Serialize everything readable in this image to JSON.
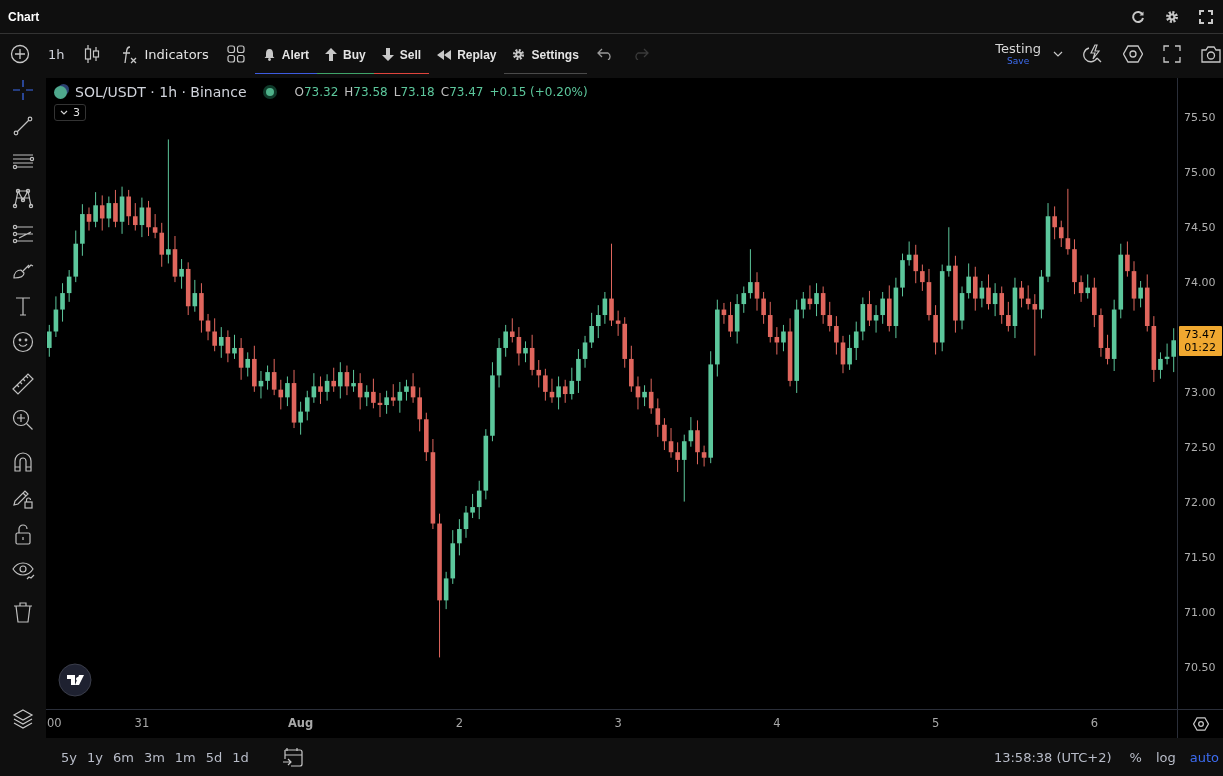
{
  "window": {
    "title": "Chart"
  },
  "toolbar": {
    "interval": "1h",
    "items": [
      {
        "kind": "indicators",
        "label": "Indicators"
      },
      {
        "kind": "alert",
        "label": "Alert",
        "color": "#3d5ce0"
      },
      {
        "kind": "buy",
        "label": "Buy",
        "color": "#3fa46a"
      },
      {
        "kind": "sell",
        "label": "Sell",
        "color": "#e0443c"
      },
      {
        "kind": "replay",
        "label": "Replay"
      },
      {
        "kind": "settings",
        "label": "Settings",
        "color": "#4a4a4a"
      }
    ],
    "redo_disabled": true,
    "layout": {
      "name": "Testing",
      "action": "Save"
    }
  },
  "tool_groups": [
    [
      {
        "kind": "crosshair",
        "selected": true
      },
      {
        "kind": "trendline",
        "selected": false
      },
      {
        "kind": "fib",
        "selected": false
      },
      {
        "kind": "pattern",
        "selected": false
      },
      {
        "kind": "projection",
        "selected": false
      },
      {
        "kind": "brush",
        "selected": false
      },
      {
        "kind": "text",
        "selected": false
      },
      {
        "kind": "emoji",
        "selected": false
      }
    ],
    [
      {
        "kind": "ruler",
        "selected": false
      },
      {
        "kind": "zoom",
        "selected": false
      }
    ],
    [
      {
        "kind": "magnet",
        "selected": false
      },
      {
        "kind": "drawlock",
        "selected": false
      },
      {
        "kind": "lock",
        "selected": false
      },
      {
        "kind": "eye",
        "selected": false
      }
    ],
    [
      {
        "kind": "trash",
        "selected": false
      }
    ]
  ],
  "legend": {
    "symbol": "SOL/USDT · 1h · Binance",
    "ohlc": [
      {
        "key": "O",
        "value": "73.32"
      },
      {
        "key": "H",
        "value": "73.58"
      },
      {
        "key": "L",
        "value": "73.18"
      },
      {
        "key": "C",
        "value": "73.47"
      }
    ],
    "change": "+0.15 (+0.20%)",
    "indicator_count": "3"
  },
  "price_chart": {
    "last_price": "73.47",
    "countdown": "01:22",
    "chart_data": {
      "type": "candlestick",
      "categories": [
        null,
        null,
        null,
        null,
        null,
        null,
        null,
        null,
        null,
        null,
        null,
        null,
        null,
        null,
        null,
        null,
        null,
        null,
        null,
        null,
        null,
        null,
        null,
        null,
        null,
        null,
        null,
        null,
        null,
        null,
        null,
        null,
        null,
        null,
        null,
        null,
        null,
        null,
        null,
        null,
        null,
        null,
        null,
        null,
        null,
        null,
        null,
        null,
        null,
        null,
        null,
        null,
        null,
        null,
        null,
        null,
        null,
        null,
        null,
        null,
        null,
        null,
        null,
        null,
        null,
        null,
        null,
        null,
        null,
        null,
        null,
        null,
        null,
        null,
        null,
        null,
        null,
        null,
        null,
        null,
        null,
        null,
        null,
        null,
        null,
        null,
        null,
        null,
        null,
        null,
        null,
        null,
        null,
        null,
        null,
        null,
        null,
        null,
        null,
        null,
        null,
        null,
        null,
        null,
        null,
        null,
        null,
        null,
        null,
        null,
        null,
        null,
        null,
        null,
        null,
        null,
        null,
        null,
        null,
        null,
        null,
        null,
        null,
        null,
        null,
        null,
        null,
        null,
        null,
        null,
        null,
        null,
        null,
        null,
        null,
        null,
        null,
        null,
        null,
        null,
        null,
        null,
        null,
        null,
        null,
        null,
        null,
        null,
        null,
        null,
        null,
        null,
        null,
        null,
        null,
        null,
        null,
        null,
        null,
        null,
        null,
        null,
        null,
        null,
        null,
        null,
        null,
        null,
        null,
        null,
        null
      ],
      "ohlc": [
        [
          73.4,
          73.61,
          73.32,
          73.55
        ],
        [
          73.55,
          73.87,
          73.5,
          73.75
        ],
        [
          73.75,
          73.99,
          73.64,
          73.9
        ],
        [
          73.9,
          74.11,
          73.82,
          74.05
        ],
        [
          74.05,
          74.47,
          74.0,
          74.35
        ],
        [
          74.35,
          74.71,
          74.24,
          74.62
        ],
        [
          74.62,
          74.68,
          74.47,
          74.55
        ],
        [
          74.55,
          74.82,
          74.5,
          74.7
        ],
        [
          74.7,
          74.79,
          74.47,
          74.58
        ],
        [
          74.58,
          74.78,
          74.5,
          74.72
        ],
        [
          74.72,
          74.84,
          74.5,
          74.55
        ],
        [
          74.55,
          74.87,
          74.44,
          74.78
        ],
        [
          74.78,
          74.84,
          74.52,
          74.6
        ],
        [
          74.6,
          74.72,
          74.47,
          74.52
        ],
        [
          74.52,
          74.77,
          74.41,
          74.68
        ],
        [
          74.68,
          74.74,
          74.42,
          74.5
        ],
        [
          74.5,
          74.62,
          74.4,
          74.45
        ],
        [
          74.45,
          74.54,
          74.14,
          74.25
        ],
        [
          74.25,
          75.3,
          74.17,
          74.3
        ],
        [
          74.3,
          74.42,
          74.0,
          74.05
        ],
        [
          74.05,
          74.21,
          73.94,
          74.12
        ],
        [
          74.12,
          74.18,
          73.7,
          73.78
        ],
        [
          73.78,
          74.02,
          73.73,
          73.9
        ],
        [
          73.9,
          73.99,
          73.54,
          73.65
        ],
        [
          73.65,
          73.71,
          73.47,
          73.55
        ],
        [
          73.55,
          73.67,
          73.37,
          73.42
        ],
        [
          73.42,
          73.59,
          73.31,
          73.5
        ],
        [
          73.5,
          73.56,
          73.27,
          73.35
        ],
        [
          73.35,
          73.52,
          73.3,
          73.4
        ],
        [
          73.4,
          73.49,
          73.11,
          73.22
        ],
        [
          73.22,
          73.36,
          73.14,
          73.3
        ],
        [
          73.3,
          73.42,
          73.0,
          73.05
        ],
        [
          73.05,
          73.19,
          72.94,
          73.1
        ],
        [
          73.1,
          73.24,
          73.02,
          73.18
        ],
        [
          73.18,
          73.3,
          72.97,
          73.02
        ],
        [
          73.02,
          73.11,
          72.84,
          72.95
        ],
        [
          72.95,
          73.14,
          72.87,
          73.08
        ],
        [
          73.08,
          73.2,
          72.67,
          72.72
        ],
        [
          72.72,
          72.91,
          72.61,
          72.82
        ],
        [
          72.82,
          73.01,
          72.74,
          72.95
        ],
        [
          72.95,
          73.17,
          72.9,
          73.05
        ],
        [
          73.05,
          73.14,
          72.89,
          73.0
        ],
        [
          73.0,
          73.16,
          72.92,
          73.1
        ],
        [
          73.1,
          73.22,
          73.0,
          73.05
        ],
        [
          73.05,
          73.27,
          72.94,
          73.18
        ],
        [
          73.18,
          73.24,
          72.97,
          73.05
        ],
        [
          73.05,
          73.2,
          73.0,
          73.08
        ],
        [
          73.08,
          73.17,
          72.84,
          72.95
        ],
        [
          72.95,
          73.06,
          72.87,
          73.0
        ],
        [
          73.0,
          73.12,
          72.85,
          72.9
        ],
        [
          72.9,
          72.99,
          72.77,
          72.88
        ],
        [
          72.88,
          73.01,
          72.8,
          72.95
        ],
        [
          72.95,
          73.07,
          72.87,
          72.92
        ],
        [
          72.92,
          73.09,
          72.81,
          73.0
        ],
        [
          73.0,
          73.11,
          72.92,
          73.05
        ],
        [
          73.05,
          73.17,
          72.9,
          72.95
        ],
        [
          72.95,
          73.04,
          72.64,
          72.75
        ],
        [
          72.75,
          72.81,
          72.37,
          72.45
        ],
        [
          72.45,
          72.57,
          71.75,
          71.8
        ],
        [
          71.8,
          71.89,
          70.58,
          71.1
        ],
        [
          71.1,
          71.36,
          71.02,
          71.3
        ],
        [
          71.3,
          71.74,
          71.25,
          71.62
        ],
        [
          71.62,
          71.84,
          71.51,
          71.75
        ],
        [
          71.75,
          71.96,
          71.67,
          71.9
        ],
        [
          71.9,
          72.07,
          71.85,
          71.95
        ],
        [
          71.95,
          72.19,
          71.84,
          72.1
        ],
        [
          72.1,
          72.66,
          72.02,
          72.6
        ],
        [
          72.6,
          73.27,
          72.55,
          73.15
        ],
        [
          73.15,
          73.49,
          73.04,
          73.4
        ],
        [
          73.4,
          73.61,
          73.32,
          73.55
        ],
        [
          73.55,
          73.67,
          73.45,
          73.5
        ],
        [
          73.5,
          73.59,
          73.24,
          73.35
        ],
        [
          73.35,
          73.46,
          73.27,
          73.4
        ],
        [
          73.4,
          73.52,
          73.15,
          73.2
        ],
        [
          73.2,
          73.29,
          73.04,
          73.15
        ],
        [
          73.15,
          73.21,
          72.92,
          73.0
        ],
        [
          73.0,
          73.12,
          72.9,
          72.95
        ],
        [
          72.95,
          73.14,
          72.84,
          73.05
        ],
        [
          73.05,
          73.11,
          72.9,
          72.98
        ],
        [
          72.98,
          73.22,
          72.93,
          73.1
        ],
        [
          73.1,
          73.39,
          72.99,
          73.3
        ],
        [
          73.3,
          73.51,
          73.22,
          73.45
        ],
        [
          73.45,
          73.72,
          73.4,
          73.6
        ],
        [
          73.6,
          73.79,
          73.49,
          73.7
        ],
        [
          73.7,
          73.91,
          73.62,
          73.85
        ],
        [
          73.85,
          74.35,
          73.6,
          73.65
        ],
        [
          73.65,
          73.74,
          73.51,
          73.62
        ],
        [
          73.62,
          73.68,
          73.22,
          73.3
        ],
        [
          73.3,
          73.42,
          73.0,
          73.05
        ],
        [
          73.05,
          73.14,
          72.84,
          72.95
        ],
        [
          72.95,
          73.06,
          72.87,
          73.0
        ],
        [
          73.0,
          73.12,
          72.8,
          72.85
        ],
        [
          72.85,
          72.94,
          72.59,
          72.7
        ],
        [
          72.7,
          72.76,
          72.47,
          72.55
        ],
        [
          72.55,
          72.67,
          72.4,
          72.45
        ],
        [
          72.45,
          72.54,
          72.27,
          72.38
        ],
        [
          72.38,
          72.61,
          72.0,
          72.55
        ],
        [
          72.55,
          72.77,
          72.5,
          72.65
        ],
        [
          72.65,
          72.74,
          72.34,
          72.45
        ],
        [
          72.45,
          72.51,
          72.32,
          72.4
        ],
        [
          72.4,
          73.37,
          72.35,
          73.25
        ],
        [
          73.25,
          73.84,
          73.14,
          73.75
        ],
        [
          73.75,
          73.81,
          73.62,
          73.7
        ],
        [
          73.7,
          73.82,
          73.5,
          73.55
        ],
        [
          73.55,
          73.89,
          73.44,
          73.8
        ],
        [
          73.8,
          73.96,
          73.72,
          73.9
        ],
        [
          73.9,
          74.3,
          73.85,
          74.0
        ],
        [
          74.0,
          74.09,
          73.74,
          73.85
        ],
        [
          73.85,
          73.91,
          73.62,
          73.7
        ],
        [
          73.7,
          73.82,
          73.45,
          73.5
        ],
        [
          73.5,
          73.59,
          73.34,
          73.45
        ],
        [
          73.45,
          73.61,
          73.37,
          73.55
        ],
        [
          73.55,
          73.67,
          73.05,
          73.1
        ],
        [
          73.1,
          73.84,
          72.99,
          73.75
        ],
        [
          73.75,
          73.91,
          73.67,
          73.85
        ],
        [
          73.85,
          73.97,
          73.75,
          73.8
        ],
        [
          73.8,
          73.99,
          73.69,
          73.9
        ],
        [
          73.9,
          73.96,
          73.62,
          73.7
        ],
        [
          73.7,
          73.82,
          73.55,
          73.6
        ],
        [
          73.6,
          73.69,
          73.34,
          73.45
        ],
        [
          73.45,
          73.51,
          73.17,
          73.25
        ],
        [
          73.25,
          73.52,
          73.2,
          73.4
        ],
        [
          73.4,
          73.64,
          73.29,
          73.55
        ],
        [
          73.55,
          73.86,
          73.47,
          73.8
        ],
        [
          73.8,
          73.92,
          73.6,
          73.65
        ],
        [
          73.65,
          73.79,
          73.54,
          73.7
        ],
        [
          73.7,
          73.91,
          73.62,
          73.85
        ],
        [
          73.85,
          73.97,
          73.55,
          73.6
        ],
        [
          73.6,
          74.04,
          73.49,
          73.95
        ],
        [
          73.95,
          74.26,
          73.87,
          74.2
        ],
        [
          74.2,
          74.37,
          74.15,
          74.25
        ],
        [
          74.25,
          74.34,
          73.99,
          74.1
        ],
        [
          74.1,
          74.16,
          73.92,
          74.0
        ],
        [
          74.0,
          74.12,
          73.65,
          73.7
        ],
        [
          73.7,
          73.79,
          73.34,
          73.45
        ],
        [
          73.45,
          74.16,
          73.37,
          74.1
        ],
        [
          74.1,
          74.5,
          74.05,
          74.15
        ],
        [
          74.15,
          74.24,
          73.54,
          73.65
        ],
        [
          73.65,
          73.96,
          73.57,
          73.9
        ],
        [
          73.9,
          74.17,
          73.85,
          74.05
        ],
        [
          74.05,
          74.14,
          73.74,
          73.85
        ],
        [
          73.85,
          74.01,
          73.77,
          73.95
        ],
        [
          73.95,
          74.07,
          73.75,
          73.8
        ],
        [
          73.8,
          73.99,
          73.69,
          73.9
        ],
        [
          73.9,
          73.96,
          73.62,
          73.7
        ],
        [
          73.7,
          73.82,
          73.55,
          73.6
        ],
        [
          73.6,
          74.04,
          73.49,
          73.95
        ],
        [
          73.95,
          74.01,
          73.77,
          73.85
        ],
        [
          73.85,
          73.97,
          73.75,
          73.8
        ],
        [
          73.8,
          73.89,
          73.33,
          73.75
        ],
        [
          73.75,
          74.11,
          73.67,
          74.05
        ],
        [
          74.05,
          74.72,
          74.0,
          74.6
        ],
        [
          74.6,
          74.69,
          74.39,
          74.5
        ],
        [
          74.5,
          74.56,
          74.32,
          74.4
        ],
        [
          74.4,
          74.85,
          74.25,
          74.3
        ],
        [
          74.3,
          74.39,
          73.89,
          74.0
        ],
        [
          74.0,
          74.06,
          73.82,
          73.9
        ],
        [
          73.9,
          74.07,
          73.85,
          73.95
        ],
        [
          73.95,
          74.04,
          73.59,
          73.7
        ],
        [
          73.7,
          73.76,
          73.32,
          73.4
        ],
        [
          73.4,
          73.52,
          73.25,
          73.3
        ],
        [
          73.3,
          73.84,
          73.19,
          73.75
        ],
        [
          73.75,
          74.35,
          73.67,
          74.25
        ],
        [
          74.25,
          74.37,
          74.05,
          74.1
        ],
        [
          74.1,
          74.19,
          73.74,
          73.85
        ],
        [
          73.85,
          74.01,
          73.77,
          73.95
        ],
        [
          73.95,
          74.07,
          73.55,
          73.6
        ],
        [
          73.6,
          73.69,
          73.09,
          73.2
        ],
        [
          73.2,
          73.36,
          73.12,
          73.3
        ],
        [
          73.3,
          73.44,
          73.25,
          73.32
        ],
        [
          73.32,
          73.58,
          73.18,
          73.47
        ]
      ],
      "ylim": [
        70.11,
        75.86
      ],
      "yticks": [
        {
          "value": 75.5,
          "label": "75.50"
        },
        {
          "value": 75,
          "label": "75.00"
        },
        {
          "value": 74.5,
          "label": "74.50"
        },
        {
          "value": 74,
          "label": "74.00"
        },
        {
          "value": 73,
          "label": "73.00"
        },
        {
          "value": 72.5,
          "label": "72.50"
        },
        {
          "value": 72,
          "label": "72.00"
        },
        {
          "value": 71.5,
          "label": "71.50"
        },
        {
          "value": 71,
          "label": "71.00"
        },
        {
          "value": 70.5,
          "label": "70.50"
        }
      ]
    },
    "time_axis": [
      "00",
      "31",
      "Aug",
      "2",
      "3",
      "4",
      "5",
      "6"
    ]
  },
  "ranges": [
    "5y",
    "1y",
    "6m",
    "3m",
    "1m",
    "5d",
    "1d"
  ],
  "clock": "13:58:38 (UTC+2)",
  "scale_options": [
    {
      "label": "%",
      "selected": false
    },
    {
      "label": "log",
      "selected": false
    },
    {
      "label": "auto",
      "selected": true
    }
  ]
}
